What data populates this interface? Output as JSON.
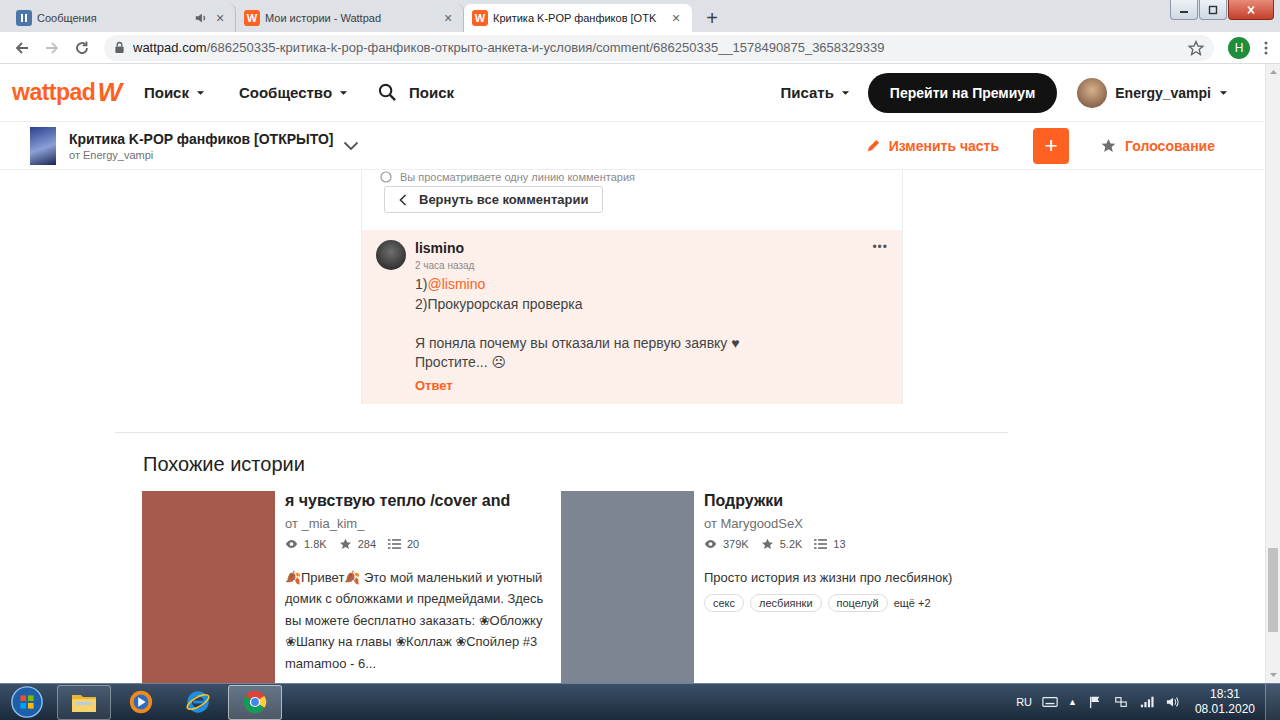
{
  "browser": {
    "tabs": [
      {
        "label": "Сообщения",
        "selected": false,
        "audio": true,
        "kind": "vk"
      },
      {
        "label": "Мои истории - Wattpad",
        "selected": false,
        "audio": false,
        "kind": "wattpad"
      },
      {
        "label": "Критика K-POP фанфиков [OTK",
        "selected": true,
        "audio": false,
        "kind": "wattpad"
      }
    ],
    "tab_close": "×",
    "new_tab": "+",
    "url_host": "wattpad.com",
    "url_path": "/686250335-критика-k-pop-фанфиков-открыто-анкета-и-условия/comment/686250335__1578490875_3658329339",
    "bookmarked": false,
    "profile_initial": "H"
  },
  "header": {
    "logo": "wattpad",
    "logo_mark": "W",
    "nav": [
      {
        "label": "Поиск"
      },
      {
        "label": "Сообщество"
      }
    ],
    "search": "Поиск",
    "write": "Писать",
    "premium": "Перейти на Премиум",
    "user": "Energy_vampi"
  },
  "story_bar": {
    "title": "Критика K-POP фанфиков [ОТКРЫТО]",
    "author": "от Energy_vampi",
    "edit": "Изменить часть",
    "add": "+",
    "vote": "Голосование",
    "voted": false
  },
  "thread": {
    "notice": "Вы просматриваете одну линию комментария",
    "back": "Вернуть все комментарии",
    "comment": {
      "author": "lismino",
      "time": "2 часа назад",
      "highlighted": true,
      "lines": [
        {
          "text": "1)",
          "mention": "@lismino"
        },
        {
          "text": "2)Прокурорская проверка",
          "mention": ""
        },
        {
          "text": "",
          "mention": ""
        },
        {
          "text": "Я поняла почему вы отказали на первую заявку ♥",
          "mention": ""
        },
        {
          "text": "Простите... ☹",
          "mention": ""
        }
      ],
      "reply": "Ответ",
      "menu": "•••"
    }
  },
  "similar": {
    "heading": "Похожие истории",
    "stories": [
      {
        "title": "я чувствую тепло /cover and",
        "author": "от _mia_kim_",
        "reads": "1.8K",
        "votes": "284",
        "parts": "20",
        "description": "🍂Привет🍂 Это мой маленький и уютный домик с обложками и предмейдами. Здесь вы можете бесплатно заказать: ❀Обложку ❀Шапку на главы ❀Коллаж ❀Спойлер #3 mamamoo - 6...",
        "tags": [],
        "more": "",
        "color": "#a65a4e"
      },
      {
        "title": "Подружки",
        "author": "от MarygoodSeX",
        "reads": "379K",
        "votes": "5.2K",
        "parts": "13",
        "description": "Просто история из жизни про лесбиянок)",
        "tags": [
          "секс",
          "лесбиянки",
          "поцелуй"
        ],
        "more": "ещё +2",
        "color": "#7d8593"
      }
    ]
  },
  "taskbar": {
    "apps": [
      {
        "kind": "explorer",
        "running": true,
        "active": false
      },
      {
        "kind": "media",
        "running": false,
        "active": false
      },
      {
        "kind": "ie",
        "running": false,
        "active": false
      },
      {
        "kind": "chrome",
        "running": true,
        "active": true
      }
    ],
    "lang": "RU",
    "tray_expand": "▲",
    "time": "18:31",
    "date": "08.01.2020"
  }
}
